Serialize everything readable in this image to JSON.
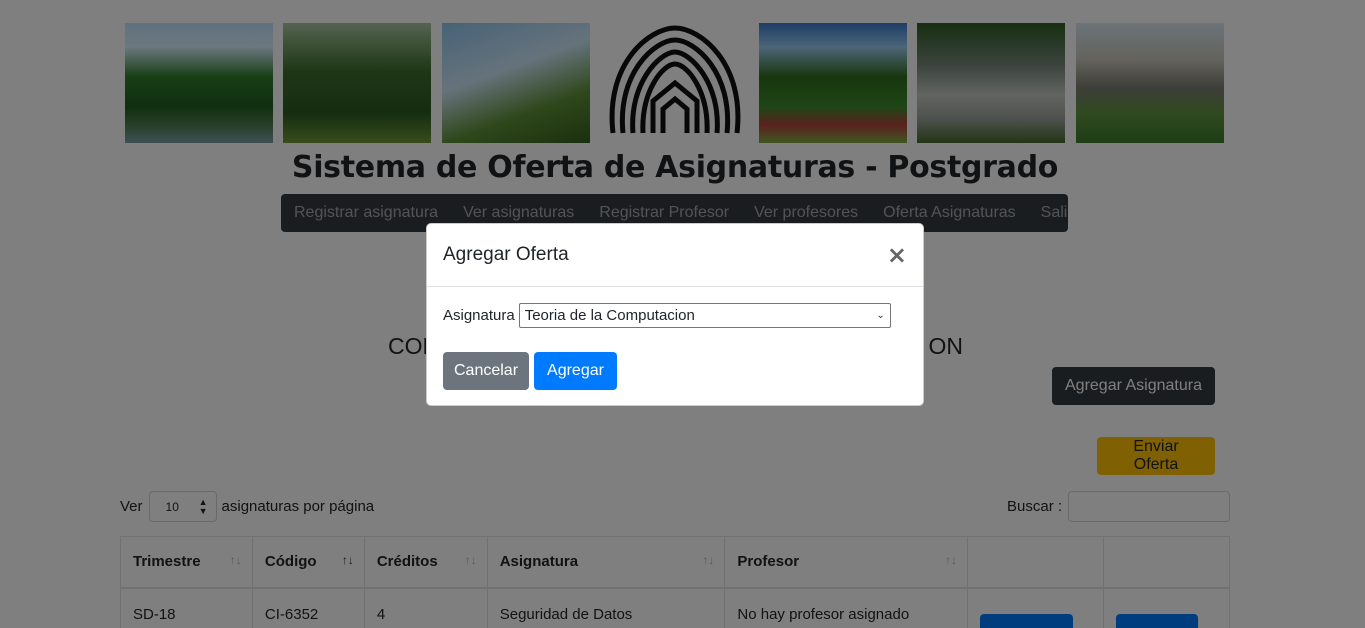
{
  "site": {
    "title": "Sistema de Oferta de Asignaturas - Postgrado"
  },
  "nav": {
    "items": [
      {
        "label": "Registrar asignatura"
      },
      {
        "label": "Ver asignaturas"
      },
      {
        "label": "Registrar Profesor"
      },
      {
        "label": "Ver profesores"
      },
      {
        "label": "Oferta Asignaturas"
      },
      {
        "label": "Salir"
      }
    ]
  },
  "section": {
    "heading_left": "CON",
    "heading_right": "ON"
  },
  "actions": {
    "add_subject": "Agregar Asignatura",
    "send_offer": "Enviar Oferta"
  },
  "pagination": {
    "prefix": "Ver",
    "page_size": "10",
    "suffix": "asignaturas por página"
  },
  "search": {
    "label": "Buscar :",
    "value": ""
  },
  "table": {
    "headers": [
      "Trimestre",
      "Código",
      "Créditos",
      "Asignatura",
      "Profesor",
      "",
      ""
    ],
    "rows": [
      {
        "trimestre": "SD-18",
        "codigo": "CI-6352",
        "creditos": "4",
        "asignatura": "Seguridad de Datos",
        "profesor": "No hay profesor asignado"
      }
    ]
  },
  "modal": {
    "title": "Agregar Oferta",
    "field_label": "Asignatura",
    "selected_subject": "Teoria de la Computacion",
    "cancel_label": "Cancelar",
    "submit_label": "Agregar"
  },
  "colors": {
    "navbar": "#343a40",
    "primary": "#007bff",
    "warning": "#ffc107",
    "secondary": "#6c757d"
  }
}
